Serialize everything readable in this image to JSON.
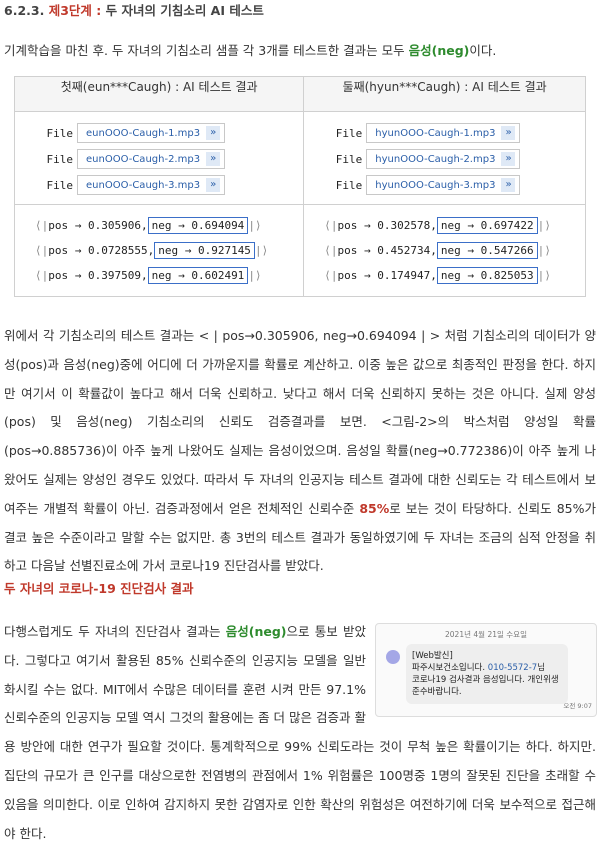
{
  "header": {
    "number": "6.2.3.",
    "title": "제3단계",
    "sep": ":",
    "rest": "두 자녀의 기침소리 AI 테스트"
  },
  "intro": {
    "pre": "기계학습을 마친 후. 두 자녀의 기침소리 샘플 각 3개를 테스트한 결과는 모두 ",
    "highlight": "음성(neg)",
    "post": "이다."
  },
  "table": {
    "headers": [
      "첫째(eun***Caugh) : AI 테스트 결과",
      "둘째(hyun***Caugh) : AI 테스트 결과"
    ],
    "file_label": "File",
    "arrow": "»",
    "files_left": [
      "eunOOO-Caugh-1.mp3",
      "eunOOO-Caugh-2.mp3",
      "eunOOO-Caugh-3.mp3"
    ],
    "files_right": [
      "hyunOOO-Caugh-1.mp3",
      "hyunOOO-Caugh-2.mp3",
      "hyunOOO-Caugh-3.mp3"
    ],
    "probs_left": [
      {
        "pos": "pos → 0.305906,",
        "neg": "neg → 0.694094"
      },
      {
        "pos": "pos → 0.0728555,",
        "neg": "neg → 0.927145"
      },
      {
        "pos": "pos → 0.397509,",
        "neg": "neg → 0.602491"
      }
    ],
    "probs_right": [
      {
        "pos": "pos → 0.302578,",
        "neg": "neg → 0.697422"
      },
      {
        "pos": "pos → 0.452734,",
        "neg": "neg → 0.547266"
      },
      {
        "pos": "pos → 0.174947,",
        "neg": "neg → 0.825053"
      }
    ],
    "open": "⟨|",
    "close": "|⟩"
  },
  "para": {
    "a": "위에서 각 기침소리의 테스트 결과는 < | pos→0.305906, neg→0.694094 | > 처럼 기침소리의 데이터가 양성(pos)과 음성(neg)중에 어디에 더 가까운지를 확률로 계산하고. 이중 높은 값으로 최종적인 판정을 한다. 하지만 여기서 이 확률값이 높다고 해서 더욱 신뢰하고. 낮다고 해서 더욱 신뢰하지 못하는 것은 아니다. 실제 양성(pos) 및 음성(neg) 기침소리의 신뢰도 검증결과를 보면. <그림-2>의 박스처럼 양성일 확률 (pos→0.885736)이 아주 높게 나왔어도 실제는 음성이었으며. 음성일 확률(neg→0.772386)이 아주 높게 나왔어도 실제는 양성인 경우도 있었다. 따라서 두 자녀의 인공지능 테스트 결과에 대한 신뢰도는 각 테스트에서 보여주는 개별적 확률이 아닌. 검증과정에서 얻은 전체적인 신뢰수준 ",
    "b": "85%",
    "c": "로 보는 것이 타당하다. 신뢰도 85%가 결코 높은 수준이라고 말할 수는 없지만. 총 3번의 테스트 결과가 동일하였기에 두 자녀는 조금의 심적 안정을 취하고 다음날 선별진료소에 가서 코로나19 진단검사를 받았다."
  },
  "section_title": "두 자녀의 코로나-19 진단검사 결과",
  "para2": {
    "a": "다행스럽게도 두 자녀의 진단검사 결과는 ",
    "b": "음성(neg)",
    "c": "으로 통보 받았다. 그렇다고 여기서 활용된 85% 신뢰수준의 인공지능 모델을 일반화시킬 수는 없다. MIT에서 수많은 데이터를 훈련 시켜 만든 97.1% 신뢰수준의 인공지능 모델 역시 그것의 활용에는 좀 더 많은 검증과 활용 방안에 대한 연구가 필요할 것이다. 통계학적으로 99% 신뢰도라는 것이 무척 높은 확률이기는 하다. 하지만. 집단의 규모가 큰 인구를 대상으로한 전염병의 관점에서 1% 위험률은 100명중 1명의 잘못된 진단을 초래할 수 있음을 의미한다. 이로 인하여 감지하지 못한 감염자로 인한 확산의 위험성은 여전하기에 더욱 보수적으로 접근해야 한다."
  },
  "sms": {
    "date": "2021년 4월 21일 수요일",
    "line1": "[Web발신]",
    "line2a": "파주시보건소입니다. ",
    "phone": "010-5572-7",
    "line2b": "님",
    "line3": "코로나19 검사결과 음성입니다. 개인위생 준수바랍니다.",
    "time": "오전 9:07"
  }
}
